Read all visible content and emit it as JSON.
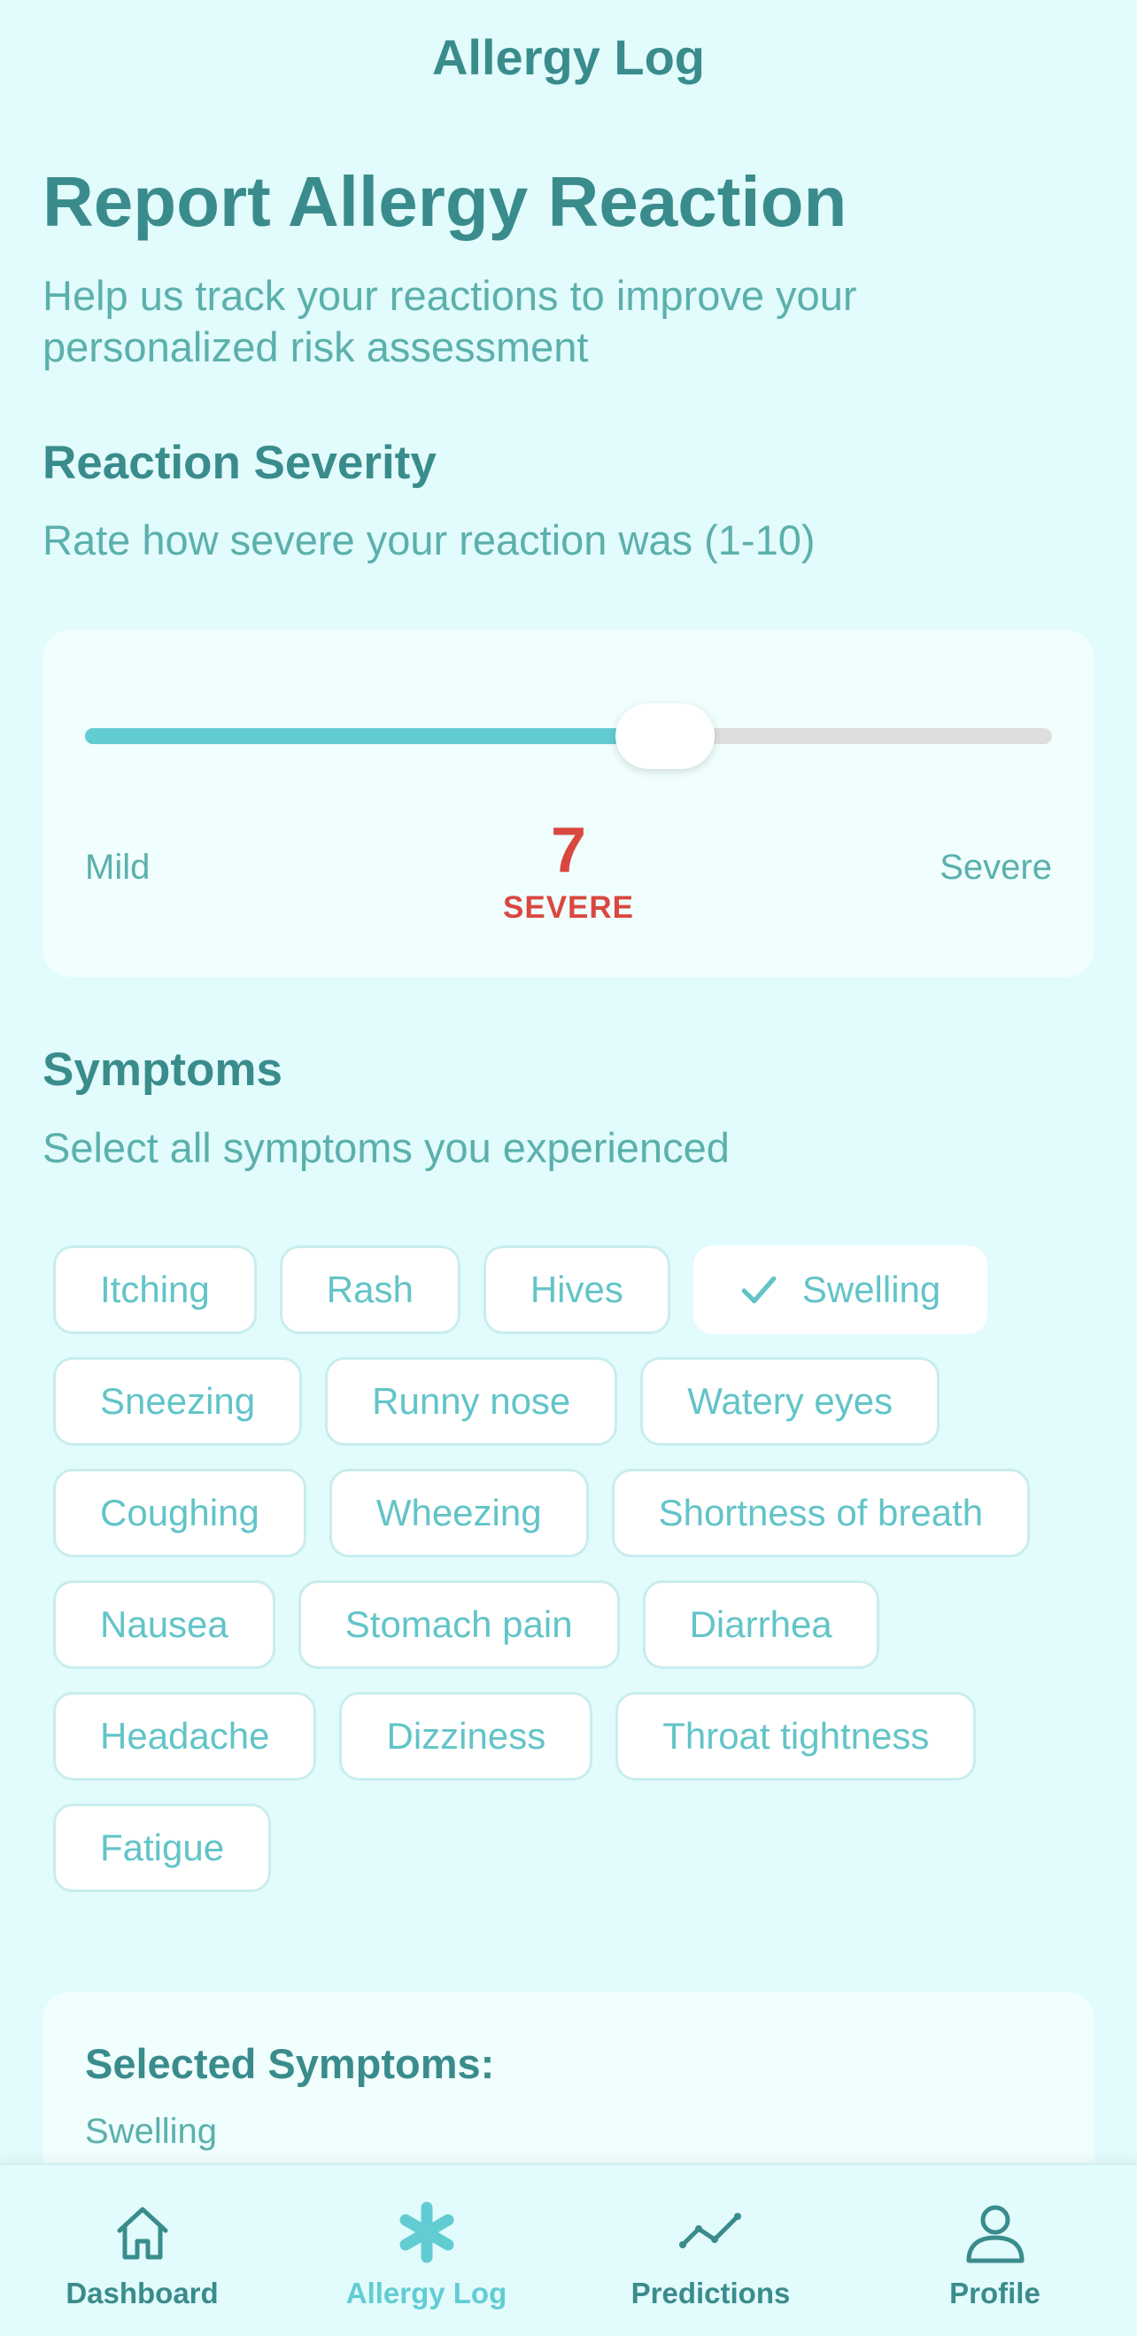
{
  "header": {
    "title": "Allergy Log"
  },
  "page": {
    "title": "Report Allergy Reaction",
    "subtitle": "Help us track your reactions to improve your personalized risk assessment"
  },
  "severity": {
    "heading": "Reaction Severity",
    "description": "Rate how severe your reaction was (1-10)",
    "min_label": "Mild",
    "max_label": "Severe",
    "value": 7,
    "value_text": "7",
    "level_label": "SEVERE",
    "slider_fraction": 0.6
  },
  "symptoms": {
    "heading": "Symptoms",
    "description": "Select all symptoms you experienced",
    "options": [
      {
        "label": "Itching",
        "selected": false
      },
      {
        "label": "Rash",
        "selected": false
      },
      {
        "label": "Hives",
        "selected": false
      },
      {
        "label": "Swelling",
        "selected": true
      },
      {
        "label": "Sneezing",
        "selected": false
      },
      {
        "label": "Runny nose",
        "selected": false
      },
      {
        "label": "Watery eyes",
        "selected": false
      },
      {
        "label": "Coughing",
        "selected": false
      },
      {
        "label": "Wheezing",
        "selected": false
      },
      {
        "label": "Shortness of breath",
        "selected": false
      },
      {
        "label": "Nausea",
        "selected": false
      },
      {
        "label": "Stomach pain",
        "selected": false
      },
      {
        "label": "Diarrhea",
        "selected": false
      },
      {
        "label": "Headache",
        "selected": false
      },
      {
        "label": "Dizziness",
        "selected": false
      },
      {
        "label": "Throat tightness",
        "selected": false
      },
      {
        "label": "Fatigue",
        "selected": false
      }
    ]
  },
  "selected_summary": {
    "title": "Selected Symptoms:",
    "value": "Swelling"
  },
  "tabbar": {
    "items": [
      {
        "label": "Dashboard",
        "icon": "house-icon",
        "active": false
      },
      {
        "label": "Allergy Log",
        "icon": "asterisk-icon",
        "active": true
      },
      {
        "label": "Predictions",
        "icon": "trend-line-icon",
        "active": false
      },
      {
        "label": "Profile",
        "icon": "person-icon",
        "active": false
      }
    ]
  },
  "colors": {
    "background": "#E2FBFC",
    "primary_text": "#3A8C8C",
    "accent": "#62CCD3",
    "severity_red": "#D9483F"
  }
}
